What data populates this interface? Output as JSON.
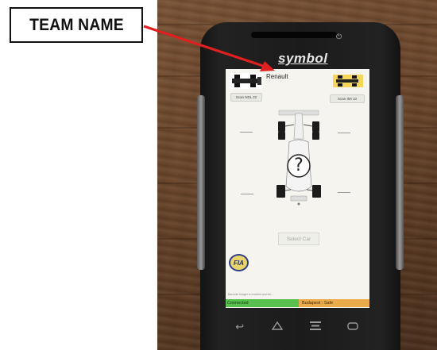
{
  "callout": {
    "label": "TEAM NAME"
  },
  "device": {
    "brand": "symbol",
    "power_icon": "power-icon"
  },
  "app": {
    "team_name": "Renault",
    "scan_left_label": "Scan NDL 22",
    "scan_right_label": "Scan IMI 10",
    "wheel_left_upper": "——",
    "wheel_right_upper": "——",
    "wheel_left_lower": "——",
    "wheel_right_lower": "——",
    "unknown_car_mark": "?",
    "select_car_label": "Select Car",
    "fia_logo_text": "FIA",
    "status_message": "Barcode Imager is enabled and ide...",
    "connection_status": "Connected",
    "location_status": "Budapest : Safe",
    "colors": {
      "connected": "#58c04e",
      "location": "#ecab4a",
      "screen_bg": "#f6f4ee",
      "arrow": "#e02020"
    }
  },
  "navbar": {
    "back_icon": "back-icon",
    "home_icon": "home-icon",
    "menu_icon": "menu-icon",
    "recent_icon": "recent-apps-icon"
  }
}
